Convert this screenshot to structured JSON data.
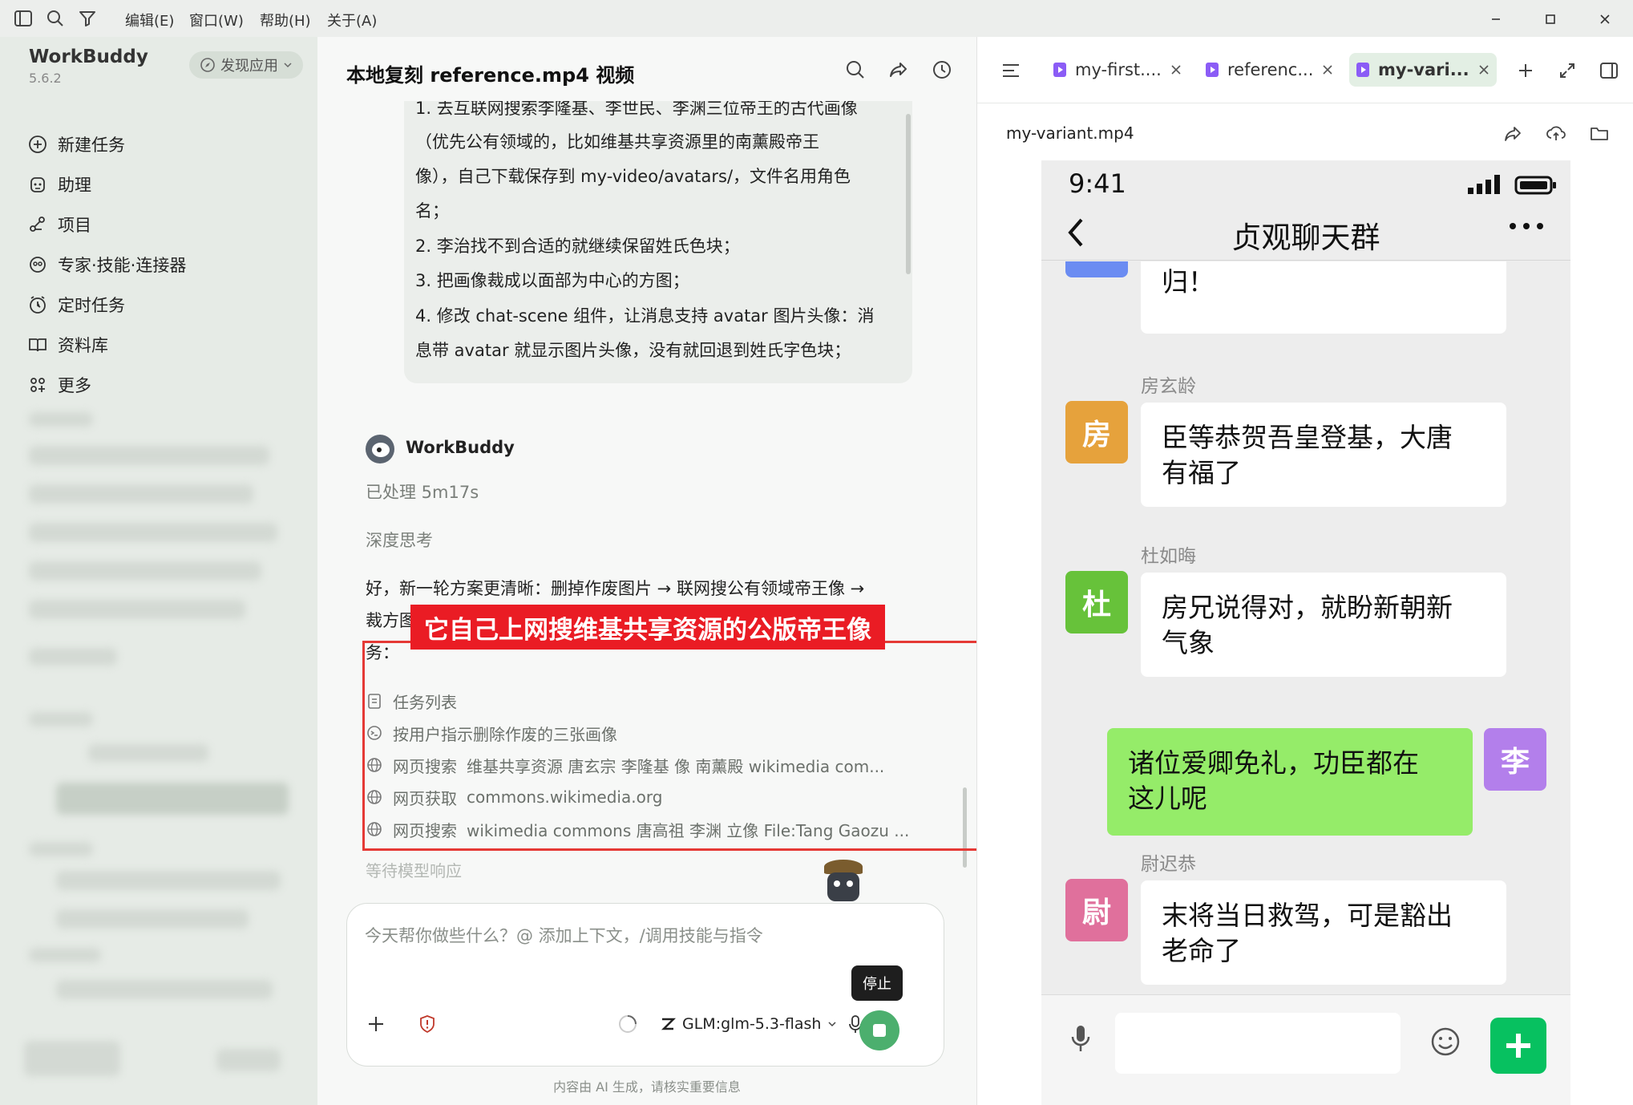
{
  "menu": {
    "edit": "编辑(E)",
    "window": "窗口(W)",
    "help": "帮助(H)",
    "about": "关于(A)"
  },
  "sidebar": {
    "app_name": "WorkBuddy",
    "version": "5.6.2",
    "discover_label": "发现应用",
    "nav": [
      {
        "label": "新建任务",
        "icon": "new-task-icon"
      },
      {
        "label": "助理",
        "icon": "assistant-icon"
      },
      {
        "label": "项目",
        "icon": "project-icon"
      },
      {
        "label": "专家·技能·连接器",
        "icon": "expert-icon"
      },
      {
        "label": "定时任务",
        "icon": "schedule-icon"
      },
      {
        "label": "资料库",
        "icon": "library-icon"
      },
      {
        "label": "更多",
        "icon": "more-icon"
      }
    ]
  },
  "chat": {
    "title": "本地复刻 reference.mp4 视频",
    "quote_lines": [
      "1. 去互联网搜索李隆基、李世民、李渊三位帝王的古代画像",
      "（优先公有领域的，比如维基共享资源里的南薰殿帝王",
      "像），自己下载保存到 my-video/avatars/，文件名用角色",
      "名；",
      "2. 李治找不到合适的就继续保留姓氏色块；",
      "3. 把画像裁成以面部为中心的方图；",
      "4. 修改 chat-scene 组件，让消息支持 avatar 图片头像：消",
      "息带 avatar 就显示图片头像，没有就回退到姓氏字色块；"
    ],
    "bot_name": "WorkBuddy",
    "processed": "已处理 5m17s",
    "deep_think": "深度思考",
    "reply_line1": "好，新一轮方案更清晰：删掉作废图片 → 联网搜公有领域帝王像 →",
    "reply_line2_start": "裁方图",
    "reply_line3": "务：",
    "overlay_label": "它自己上网搜维基共享资源的公版帝王像",
    "tools": [
      {
        "icon": "task-list-icon",
        "label": "任务列表",
        "detail": ""
      },
      {
        "icon": "terminal-icon",
        "label": "按用户指示删除作废的三张画像",
        "detail": ""
      },
      {
        "icon": "globe-icon",
        "label": "网页搜索",
        "detail": "维基共享资源 唐玄宗 李隆基 像 南薰殿 wikimedia com..."
      },
      {
        "icon": "globe-icon",
        "label": "网页获取",
        "detail": "commons.wikimedia.org"
      },
      {
        "icon": "globe-icon",
        "label": "网页搜索",
        "detail": "wikimedia commons 唐高祖 李渊 立像 File:Tang Gaozu ..."
      }
    ],
    "waiting": "等待模型响应",
    "input_placeholder": "今天帮你做些什么？@ 添加上下文，/调用技能与指令",
    "model": "GLM:glm-5.3-flash",
    "stop_tooltip": "停止",
    "disclaimer": "内容由 AI 生成，请核实重要信息"
  },
  "preview": {
    "tabs": [
      "my-first....",
      "referenc...",
      "my-vari..."
    ],
    "file_name": "my-variant.mp4",
    "phone": {
      "time": "9:41",
      "chat_title": "贞观聊天群",
      "partial_bubble_text": "归！",
      "messages": [
        {
          "name": "房玄龄",
          "avatar": "房",
          "color": "#e6a23c",
          "line1": "臣等恭贺吾皇登基，大唐",
          "line2": "有福了"
        },
        {
          "name": "杜如晦",
          "avatar": "杜",
          "color": "#67c23a",
          "line1": "房兄说得对，就盼新朝新",
          "line2": "气象"
        },
        {
          "name": "",
          "avatar": "李",
          "color": "#b37feb",
          "line1": "诸位爱卿免礼，功臣都在",
          "line2": "这儿呢"
        },
        {
          "name": "尉迟恭",
          "avatar": "尉",
          "color": "#e0709c",
          "line1": "末将当日救驾，可是豁出",
          "line2": "老命了"
        }
      ]
    }
  },
  "colors": {
    "accent": "#4caf6e",
    "highlight": "#ea1c24",
    "self_bubble": "#95ec69",
    "tab_active": "#e3efe4"
  }
}
